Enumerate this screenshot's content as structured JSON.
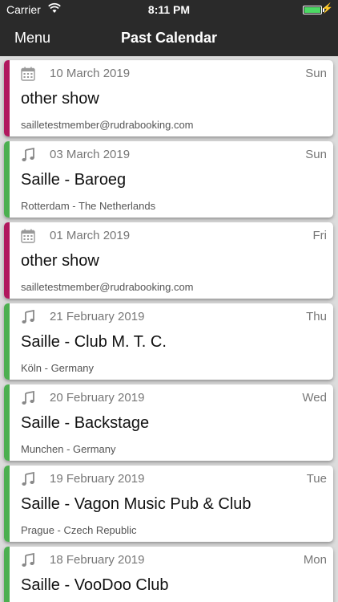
{
  "status_bar": {
    "carrier": "Carrier",
    "time": "8:11 PM",
    "battery_level": 1.0,
    "battery_color": "#4cd964"
  },
  "nav": {
    "menu_label": "Menu",
    "title": "Past Calendar"
  },
  "colors": {
    "show": "#b0185e",
    "gig": "#4caf50"
  },
  "events": [
    {
      "type": "show",
      "icon": "calendar-icon",
      "date": "10 March 2019",
      "day": "Sun",
      "title": "other show",
      "subtitle": "sailletestmember@rudrabooking.com"
    },
    {
      "type": "gig",
      "icon": "music-note-icon",
      "date": "03 March 2019",
      "day": "Sun",
      "title": "Saille - Baroeg",
      "subtitle": "Rotterdam - The Netherlands"
    },
    {
      "type": "show",
      "icon": "calendar-icon",
      "date": "01 March 2019",
      "day": "Fri",
      "title": "other show",
      "subtitle": "sailletestmember@rudrabooking.com"
    },
    {
      "type": "gig",
      "icon": "music-note-icon",
      "date": "21 February 2019",
      "day": "Thu",
      "title": "Saille - Club M. T. C.",
      "subtitle": "Köln - Germany"
    },
    {
      "type": "gig",
      "icon": "music-note-icon",
      "date": "20 February 2019",
      "day": "Wed",
      "title": "Saille - Backstage",
      "subtitle": "Munchen - Germany"
    },
    {
      "type": "gig",
      "icon": "music-note-icon",
      "date": "19 February 2019",
      "day": "Tue",
      "title": "Saille - Vagon Music Pub & Club",
      "subtitle": "Prague - Czech Republic"
    },
    {
      "type": "gig",
      "icon": "music-note-icon",
      "date": "18 February 2019",
      "day": "Mon",
      "title": "Saille - VooDoo Club",
      "subtitle": ""
    }
  ]
}
